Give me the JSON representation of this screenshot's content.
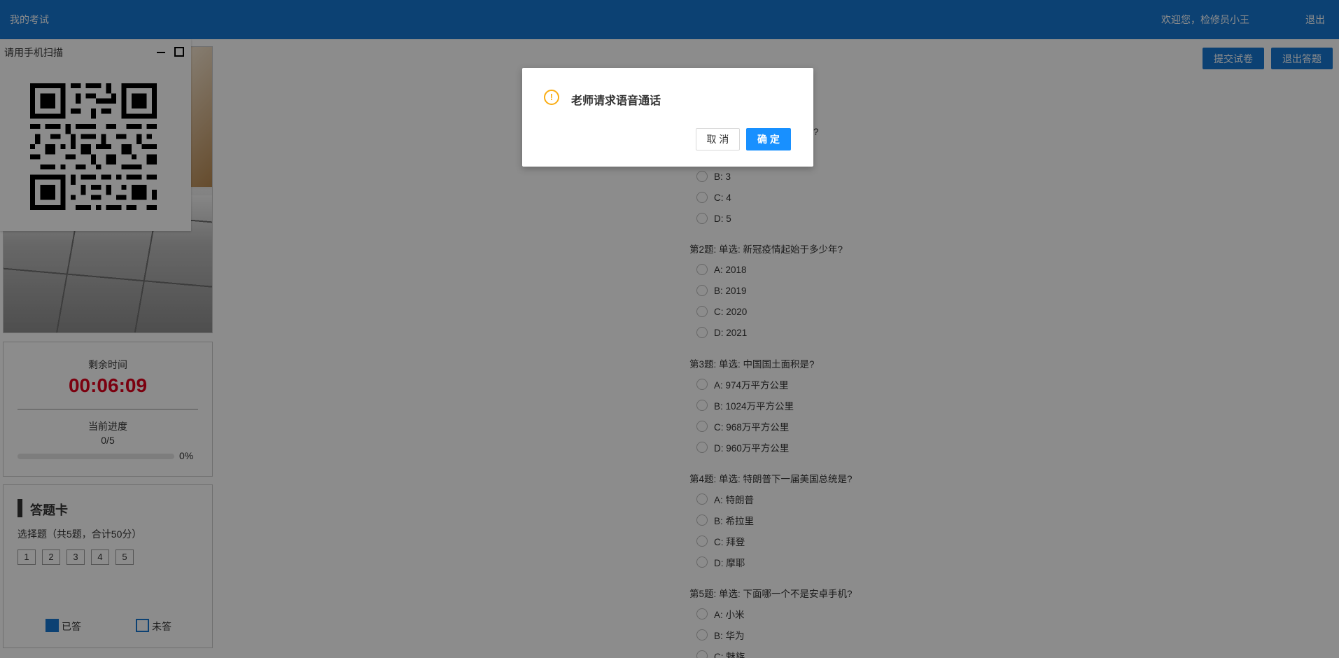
{
  "header": {
    "title": "我的考试",
    "welcome": "欢迎您，检修员小王",
    "logout": "退出"
  },
  "actions": {
    "submit_label": "提交试卷",
    "exit_label": "退出答题"
  },
  "qr_panel": {
    "title": "请用手机扫描",
    "icons": [
      "minimize-icon",
      "maximize-icon",
      "qr-code-icon"
    ]
  },
  "timer": {
    "remaining_label": "剩余时间",
    "remaining_value": "00:06:09",
    "progress_label": "当前进度",
    "progress_value": "0/5",
    "progress_fraction": 0,
    "progress_percent": "0%",
    "time_color": "#e0001c"
  },
  "answer_card": {
    "title": "答题卡",
    "subtitle": "选择题（共5题，合计50分）",
    "numbers": [
      "1",
      "2",
      "3",
      "4",
      "5"
    ],
    "legend_answered": "已答",
    "legend_unanswered": "未答"
  },
  "questions": [
    {
      "title": "?",
      "options": [
        "B: 3",
        "C: 4",
        "D: 5"
      ]
    },
    {
      "title": "第2题: 单选: 新冠疫情起始于多少年?",
      "options": [
        "A: 2018",
        "B: 2019",
        "C: 2020",
        "D: 2021"
      ]
    },
    {
      "title": "第3题: 单选: 中国国土面积是?",
      "options": [
        "A: 974万平方公里",
        "B: 1024万平方公里",
        "C: 968万平方公里",
        "D: 960万平方公里"
      ]
    },
    {
      "title": "第4题: 单选: 特朗普下一届美国总统是?",
      "options": [
        "A: 特朗普",
        "B: 希拉里",
        "C: 拜登",
        "D: 摩耶"
      ]
    },
    {
      "title": "第5题: 单选: 下面哪一个不是安卓手机?",
      "options": [
        "A: 小米",
        "B: 华为",
        "C: 魅族"
      ]
    }
  ],
  "dialog": {
    "message": "老师请求语音通话",
    "icon": "warning-icon",
    "cancel_label": "取 消",
    "ok_label": "确 定"
  },
  "colors": {
    "primary": "#1677d2",
    "dialog_ok": "#1890ff",
    "warning": "#faad14"
  }
}
